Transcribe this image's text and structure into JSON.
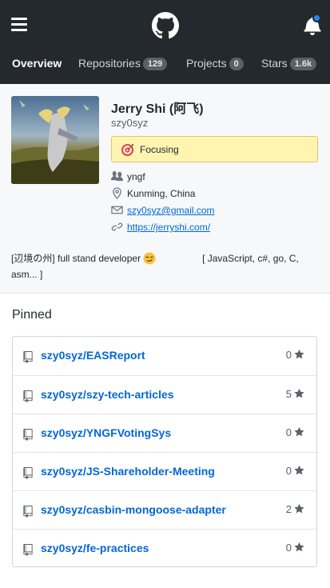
{
  "header": {
    "menu_icon": "hamburger-icon",
    "logo_icon": "github-octocat-icon",
    "notification_icon": "bell-icon",
    "notification_dot_color": "#2188ff",
    "background_color": "#24292e"
  },
  "tabs": [
    {
      "label": "Overview",
      "count": null,
      "active": true
    },
    {
      "label": "Repositories",
      "count": "129",
      "active": false
    },
    {
      "label": "Projects",
      "count": "0",
      "active": false
    },
    {
      "label": "Stars",
      "count": "1.6k",
      "active": false
    }
  ],
  "profile": {
    "name": "Jerry Shi (阿飞)",
    "login": "szy0syz",
    "status": {
      "emoji": "target-emoji",
      "text": "Focusing"
    },
    "organization": "yngf",
    "location": "Kunming, China",
    "email": "szy0syz@gmail.com",
    "website": "https://jerryshi.com/",
    "bio_part1": "[辺境の州] full stand developer",
    "bio_emoji": "smirk-emoji",
    "bio_part2": "[ JavaScript, c#, go, C, asm... ]"
  },
  "pinned": {
    "title": "Pinned",
    "repos": [
      {
        "name": "szy0syz/EASReport",
        "stars": "0"
      },
      {
        "name": "szy0syz/szy-tech-articles",
        "stars": "5"
      },
      {
        "name": "szy0syz/YNGFVotingSys",
        "stars": "0"
      },
      {
        "name": "szy0syz/JS-Shareholder-Meeting",
        "stars": "0"
      },
      {
        "name": "szy0syz/casbin-mongoose-adapter",
        "stars": "2"
      },
      {
        "name": "szy0syz/fe-practices",
        "stars": "0"
      }
    ]
  }
}
